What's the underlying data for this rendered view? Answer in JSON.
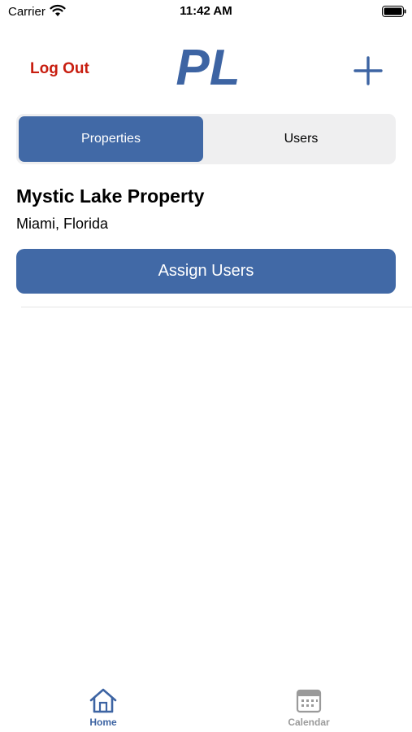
{
  "status_bar": {
    "carrier": "Carrier",
    "time": "11:42 AM"
  },
  "nav": {
    "logout_label": "Log Out",
    "logo_text": "PL",
    "add_icon": "plus-icon"
  },
  "segments": {
    "properties_label": "Properties",
    "users_label": "Users",
    "selected": "Properties"
  },
  "property": {
    "name": "Mystic Lake Property",
    "location": "Miami, Florida",
    "assign_label": "Assign Users"
  },
  "tab_bar": {
    "items": [
      {
        "label": "Home",
        "icon": "home-icon",
        "active": true
      },
      {
        "label": "Calendar",
        "icon": "calendar-icon",
        "active": false
      }
    ]
  },
  "colors": {
    "accent": "#4169a6",
    "logout": "#c81e10",
    "inactive_tab": "#9a9a9a"
  }
}
